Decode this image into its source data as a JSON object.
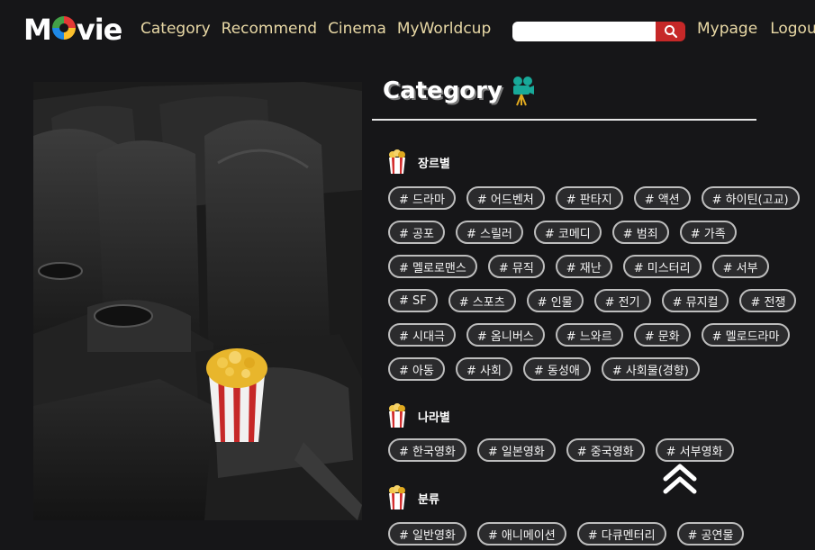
{
  "header": {
    "logo": "Movie",
    "nav": [
      "Category",
      "Recommend",
      "Cinema",
      "MyWorldcup"
    ],
    "search_placeholder": "",
    "right_nav": [
      "Mypage",
      "Logout"
    ]
  },
  "page": {
    "title": "Category"
  },
  "sections": [
    {
      "label": "장르별",
      "tags": [
        "# 드라마",
        "# 어드벤처",
        "# 판타지",
        "# 액션",
        "# 하이틴(고교)",
        "# 공포",
        "# 스릴러",
        "# 코메디",
        "# 범죄",
        "# 가족",
        "# 멜로로맨스",
        "# 뮤직",
        "# 재난",
        "# 미스터리",
        "# 서부",
        "# SF",
        "# 스포츠",
        "# 인물",
        "# 전기",
        "# 뮤지컬",
        "# 전쟁",
        "# 시대극",
        "# 옴니버스",
        "# 느와르",
        "# 문화",
        "# 멜로드라마",
        "# 아동",
        "# 사회",
        "# 동성애",
        "# 사회물(경향)"
      ]
    },
    {
      "label": "나라별",
      "tags": [
        "# 한국영화",
        "# 일본영화",
        "# 중국영화",
        "# 서부영화"
      ]
    },
    {
      "label": "분류",
      "tags": [
        "# 일반영화",
        "# 애니메이션",
        "# 다큐멘터리",
        "# 공연물"
      ]
    }
  ],
  "colors": {
    "background": "#161618",
    "nav_text": "#e9d9a6",
    "search_button": "#c62828",
    "tag_border": "#bdbdbd"
  }
}
